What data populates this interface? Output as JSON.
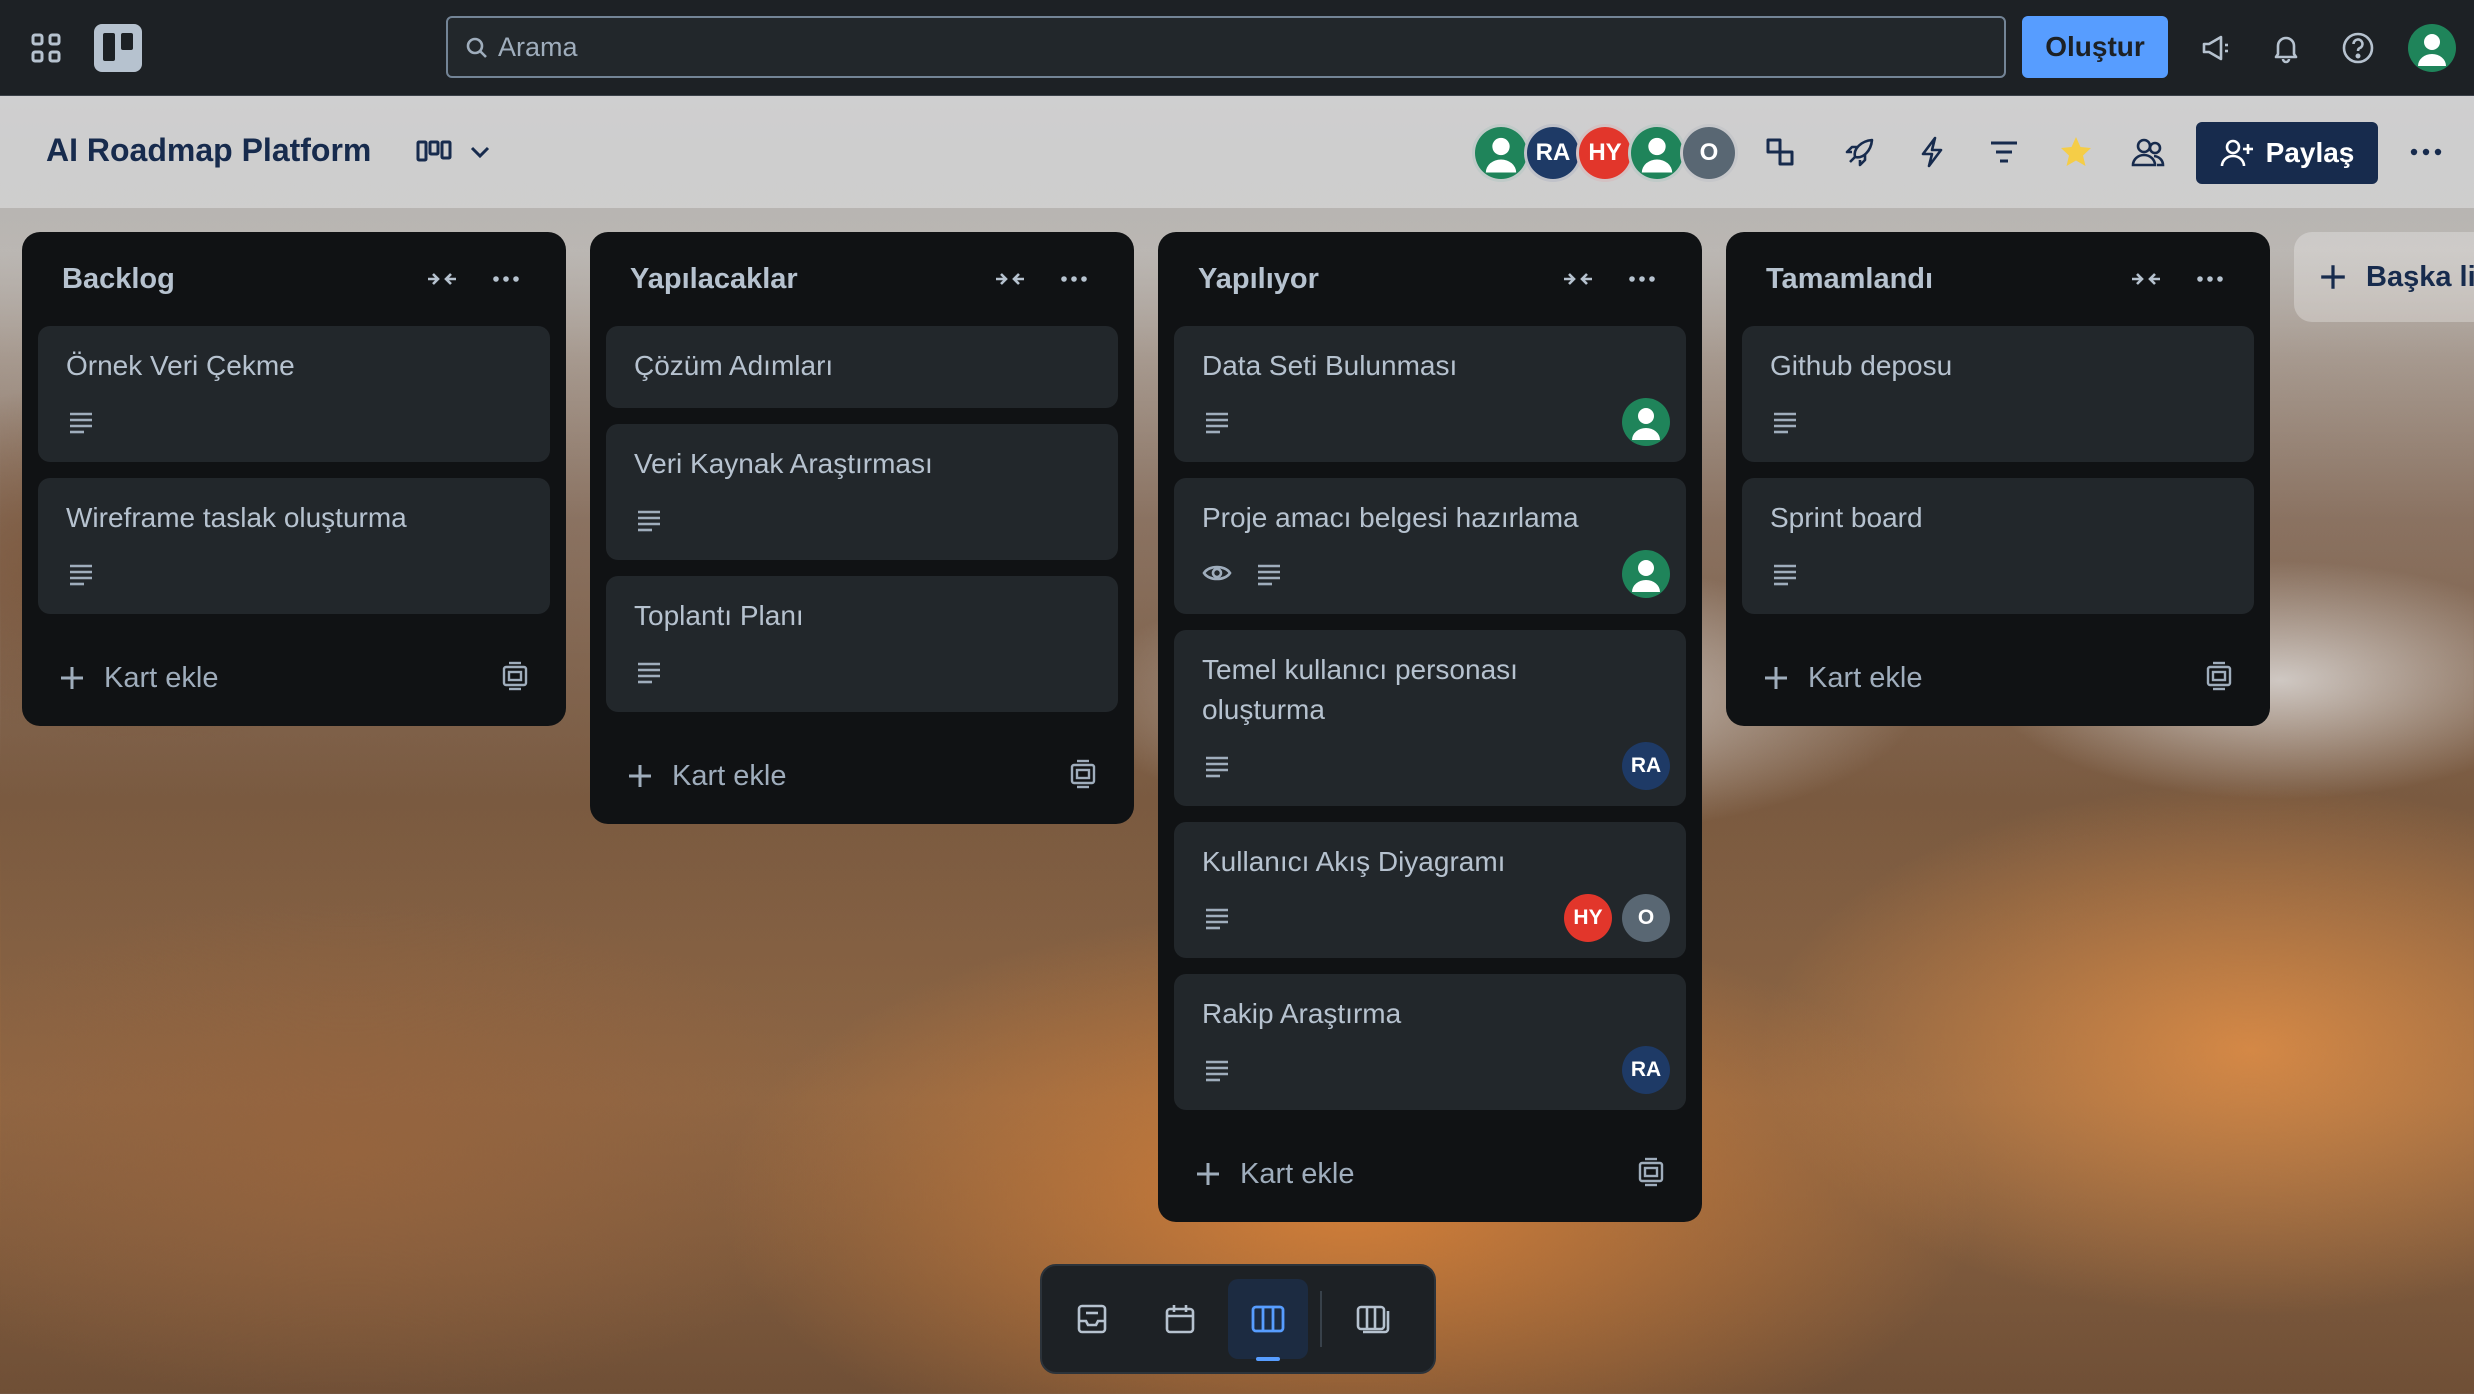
{
  "topbar": {
    "search_placeholder": "Arama",
    "create_label": "Oluştur",
    "icons": [
      "apps-icon",
      "trello-logo-icon",
      "search-icon",
      "megaphone-icon",
      "bell-icon",
      "help-icon",
      "user-avatar-icon"
    ]
  },
  "board": {
    "title": "AI Roadmap Platform",
    "members": [
      {
        "initials": "",
        "color": "#1f845a"
      },
      {
        "initials": "RA",
        "color": "#1e3a66"
      },
      {
        "initials": "HY",
        "color": "#e2362b"
      },
      {
        "initials": "",
        "color": "#1f845a"
      },
      {
        "initials": "O",
        "color": "#596773"
      }
    ],
    "share_label": "Paylaş",
    "add_list_label": "Başka lis"
  },
  "lists": [
    {
      "title": "Backlog",
      "cards": [
        {
          "title": "Örnek Veri Çekme"
        },
        {
          "title": "Wireframe taslak oluşturma"
        }
      ],
      "add_card_label": "Kart ekle"
    },
    {
      "title": "Yapılacaklar",
      "cards": [
        {
          "title": "Çözüm Adımları"
        },
        {
          "title": "Veri Kaynak Araştırması"
        },
        {
          "title": "Toplantı Planı"
        }
      ],
      "add_card_label": "Kart ekle"
    },
    {
      "title": "Yapılıyor",
      "cards": [
        {
          "title": "Data Seti Bulunması",
          "members": [
            "user"
          ]
        },
        {
          "title": "Proje amacı belgesi hazırlama",
          "members": [
            "user"
          ],
          "watching": true
        },
        {
          "title": "Temel kullanıcı personası oluşturma",
          "members": [
            "RA"
          ]
        },
        {
          "title": "Kullanıcı Akış Diyagramı",
          "members": [
            "HY",
            "O"
          ]
        },
        {
          "title": "Rakip Araştırma",
          "members": [
            "RA"
          ]
        }
      ],
      "add_card_label": "Kart ekle"
    },
    {
      "title": "Tamamlandı",
      "cards": [
        {
          "title": "Github deposu"
        },
        {
          "title": "Sprint board"
        }
      ],
      "add_card_label": "Kart ekle"
    }
  ],
  "colors": {
    "topbar_bg": "#1d2125",
    "accent": "#579dff",
    "list_bg": "#101214",
    "card_bg": "#22272b",
    "text": "#b6c2cf"
  }
}
